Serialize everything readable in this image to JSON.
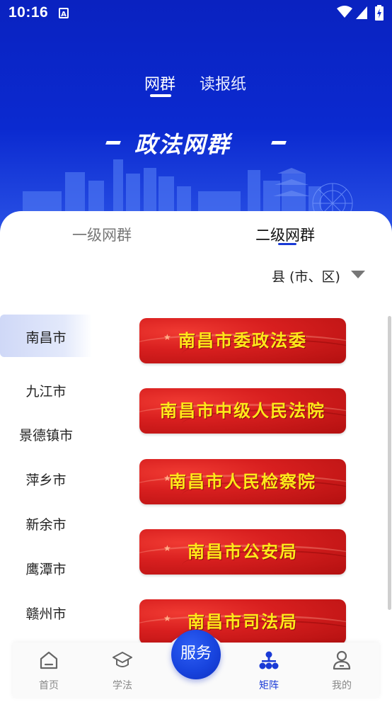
{
  "status_bar": {
    "time": "10:16"
  },
  "top_tabs": [
    {
      "label": "网群",
      "active": true
    },
    {
      "label": "读报纸",
      "active": false
    }
  ],
  "banner": {
    "title": "政法网群"
  },
  "level_tabs": [
    {
      "label": "一级网群",
      "active": false
    },
    {
      "label": "二级网群",
      "active": true
    }
  ],
  "county_filter": {
    "label": "县 (市、区)"
  },
  "cities": [
    {
      "label": "南昌市",
      "selected": true
    },
    {
      "label": "九江市",
      "selected": false
    },
    {
      "label": "景德镇市",
      "selected": false
    },
    {
      "label": "萍乡市",
      "selected": false
    },
    {
      "label": "新余市",
      "selected": false
    },
    {
      "label": "鹰潭市",
      "selected": false
    },
    {
      "label": "赣州市",
      "selected": false
    }
  ],
  "organizations": [
    {
      "label": "南昌市委政法委"
    },
    {
      "label": "南昌市中级人民法院"
    },
    {
      "label": "南昌市人民检察院"
    },
    {
      "label": "南昌市公安局"
    },
    {
      "label": "南昌市司法局"
    }
  ],
  "bottom_nav": [
    {
      "label": "首页",
      "icon": "home-icon",
      "active": false
    },
    {
      "label": "学法",
      "icon": "graduation-cap-icon",
      "active": false
    },
    {
      "label": "服务",
      "icon": "service-button",
      "active": false
    },
    {
      "label": "矩阵",
      "icon": "matrix-icon",
      "active": true
    },
    {
      "label": "我的",
      "icon": "user-icon",
      "active": false
    }
  ],
  "colors": {
    "primary": "#1a3ad6",
    "header": "#0b2ad0",
    "card_red": "#d81f1f",
    "card_text": "#ffe81a"
  }
}
